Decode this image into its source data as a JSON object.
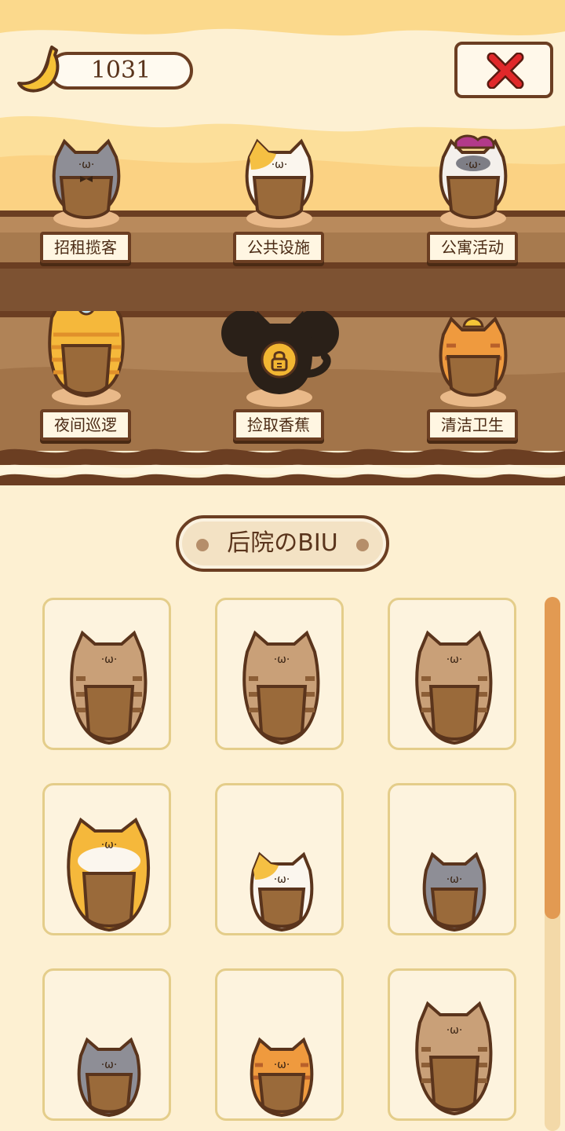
{
  "currency": {
    "icon": "banana-icon",
    "amount": "1031"
  },
  "close_button": {
    "icon": "close-x-icon",
    "color": "#e0282a"
  },
  "roles": [
    {
      "label": "招租揽客",
      "cat": "gray-cat",
      "locked": false
    },
    {
      "label": "公共设施",
      "cat": "calico-cat",
      "locked": false
    },
    {
      "label": "公寓活动",
      "cat": "white-jester-cat",
      "locked": false
    },
    {
      "label": "夜间巡逻",
      "cat": "goggles-orange-cat",
      "locked": false
    },
    {
      "label": "捡取香蕉",
      "cat": "silhouette-cat",
      "locked": true
    },
    {
      "label": "清洁卫生",
      "cat": "helmet-orange-tabby",
      "locked": false
    }
  ],
  "section_title": "后院のBIU",
  "cats": [
    "brown-tabby-cat",
    "brown-tabby-cat",
    "brown-tabby-cat",
    "orange-white-cat",
    "calico-cat",
    "gray-cat",
    "gray-cat",
    "orange-tabby-cat",
    "brown-tabby-cat"
  ],
  "colors": {
    "background": "#fdf0d2",
    "border": "#6b3e22",
    "accent": "#e29a52"
  }
}
